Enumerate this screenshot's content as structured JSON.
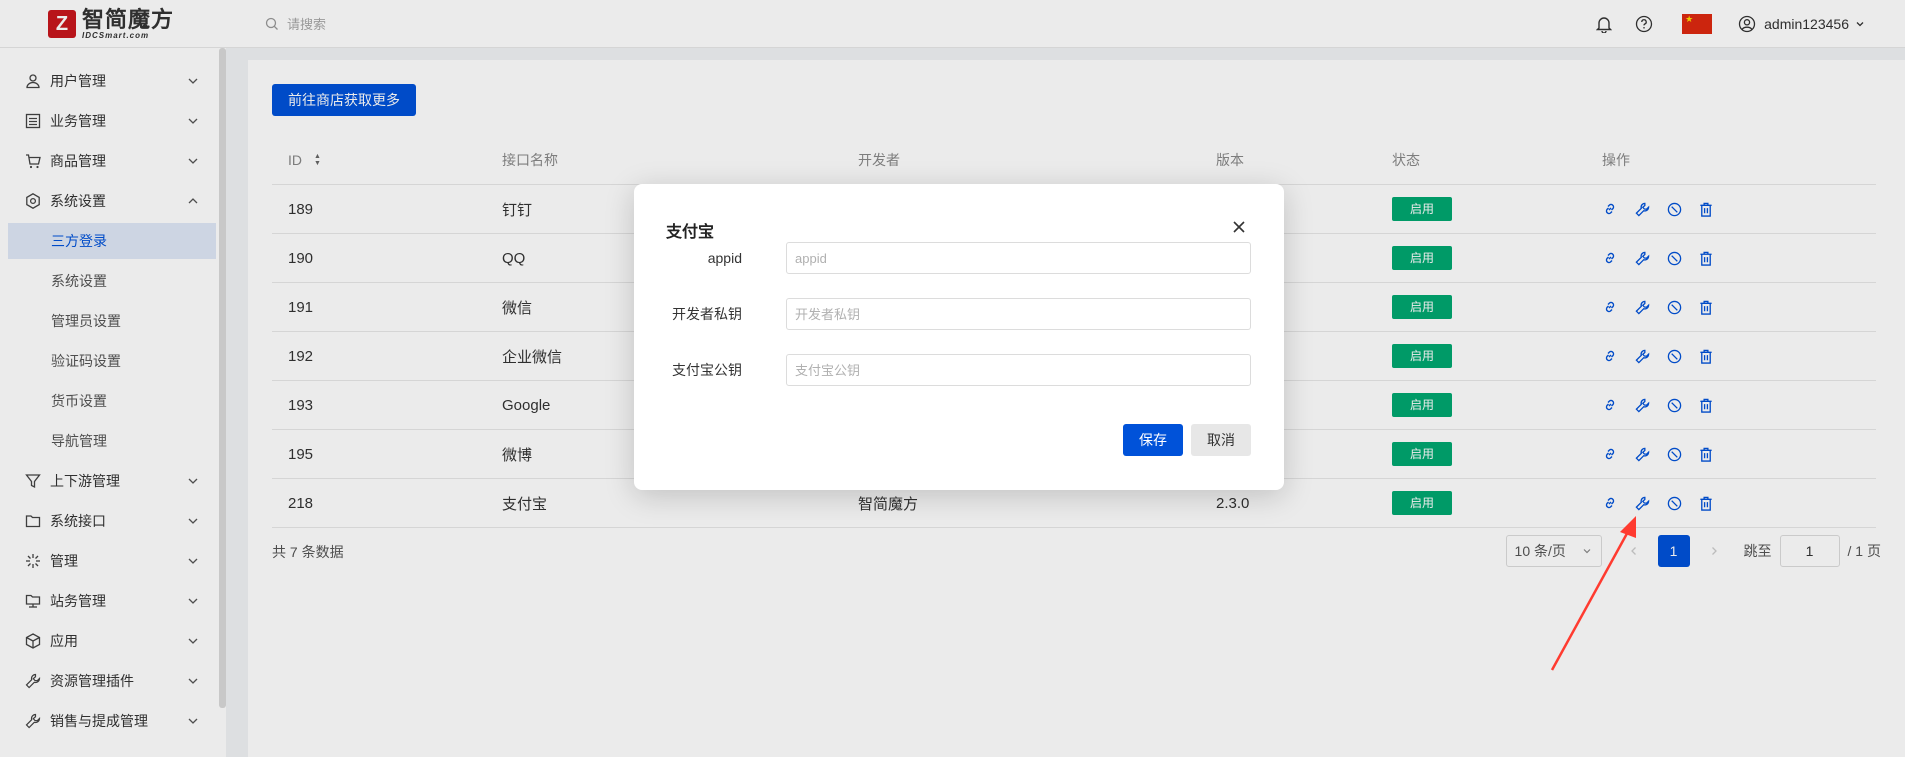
{
  "header": {
    "logo_text": "智简魔方",
    "logo_sub": "IDCSmart.com",
    "logo_mark": "Z",
    "search_placeholder": "请搜索",
    "username": "admin123456",
    "icons": [
      "bell-icon",
      "help-icon",
      "flag-cn-icon",
      "user-icon"
    ]
  },
  "sidebar": {
    "items": [
      {
        "label": "用户管理",
        "icon": "user-icon",
        "expanded": false
      },
      {
        "label": "业务管理",
        "icon": "list-icon",
        "expanded": false
      },
      {
        "label": "商品管理",
        "icon": "cart-icon",
        "expanded": false
      },
      {
        "label": "系统设置",
        "icon": "gear-icon",
        "expanded": true
      },
      {
        "label": "上下游管理",
        "icon": "filter-icon",
        "expanded": false
      },
      {
        "label": "系统接口",
        "icon": "folder-icon",
        "expanded": false
      },
      {
        "label": "管理",
        "icon": "burst-icon",
        "expanded": false
      },
      {
        "label": "站务管理",
        "icon": "folder-network-icon",
        "expanded": false
      },
      {
        "label": "应用",
        "icon": "cube-icon",
        "expanded": false
      },
      {
        "label": "资源管理插件",
        "icon": "wrench-icon",
        "expanded": false
      },
      {
        "label": "销售与提成管理",
        "icon": "wrench-icon",
        "expanded": false
      }
    ],
    "sub_items": [
      {
        "label": "三方登录",
        "active": true
      },
      {
        "label": "系统设置",
        "active": false
      },
      {
        "label": "管理员设置",
        "active": false
      },
      {
        "label": "验证码设置",
        "active": false
      },
      {
        "label": "货币设置",
        "active": false
      },
      {
        "label": "导航管理",
        "active": false
      }
    ]
  },
  "main": {
    "store_button": "前往商店获取更多",
    "columns": {
      "id": "ID",
      "name": "接口名称",
      "developer": "开发者",
      "version": "版本",
      "status": "状态",
      "ops": "操作"
    },
    "rows": [
      {
        "id": "189",
        "name": "钉钉",
        "developer": "",
        "version": "",
        "status": "启用"
      },
      {
        "id": "190",
        "name": "QQ",
        "developer": "",
        "version": "",
        "status": "启用"
      },
      {
        "id": "191",
        "name": "微信",
        "developer": "",
        "version": "",
        "status": "启用"
      },
      {
        "id": "192",
        "name": "企业微信",
        "developer": "",
        "version": "",
        "status": "启用"
      },
      {
        "id": "193",
        "name": "Google",
        "developer": "",
        "version": "",
        "status": "启用"
      },
      {
        "id": "195",
        "name": "微博",
        "developer": "",
        "version": "",
        "status": "启用"
      },
      {
        "id": "218",
        "name": "支付宝",
        "developer": "智简魔方",
        "version": "2.3.0",
        "status": "启用"
      }
    ],
    "total": "共 7 条数据",
    "pager": {
      "page_size": "10 条/页",
      "current": "1",
      "jump_label": "跳至",
      "jump_value": "1",
      "total_pages": "/ 1 页"
    }
  },
  "dialog": {
    "title": "支付宝",
    "fields": [
      {
        "label": "appid",
        "placeholder": "appid",
        "value": ""
      },
      {
        "label": "开发者私钥",
        "placeholder": "开发者私钥",
        "value": ""
      },
      {
        "label": "支付宝公钥",
        "placeholder": "支付宝公钥",
        "value": ""
      }
    ],
    "save": "保存",
    "cancel": "取消"
  },
  "colors": {
    "primary": "#0052d9",
    "success": "#00a870",
    "annotation": "#ff3b30"
  }
}
